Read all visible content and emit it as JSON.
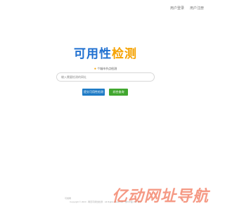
{
  "nav": {
    "login": "用户登录",
    "register": "用户注册"
  },
  "logo": {
    "part1": "可用性",
    "part2": "检测"
  },
  "hint": {
    "text": "个城市节点检测"
  },
  "search": {
    "placeholder": "输入需要检测的网址"
  },
  "buttons": {
    "primary": "提交可用性检测",
    "secondary": "综合查询"
  },
  "footer": {
    "brand": "可用网",
    "line": "Copyright © 2023 · 网页可用性检测 · All Rights Reserved · 豫ICP备 0xx 号-1"
  },
  "watermark": {
    "text": "亿动网址导航"
  },
  "colors": {
    "logo_blue": "#1e6fd0",
    "logo_orange": "#f5a200",
    "button_blue": "#1e7bc6",
    "button_green": "#41a72f",
    "watermark": "#f05c3a"
  }
}
